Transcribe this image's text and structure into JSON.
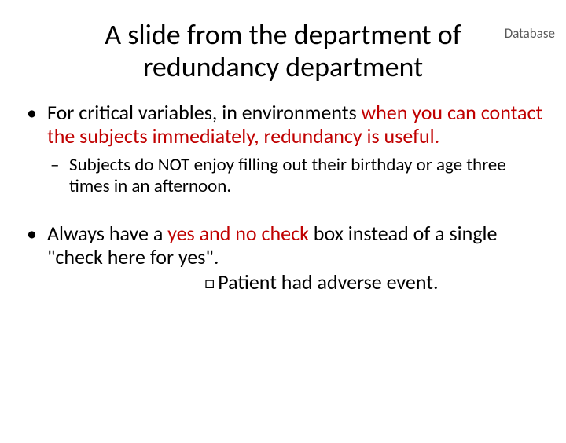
{
  "corner_label": "Database",
  "title": "A slide from the department of redundancy department",
  "bullets": {
    "b1_pre": "For critical variables, in environments ",
    "b1_red": "when you can contact the subjects immediately, redundancy is useful.",
    "b1_sub": "Subjects do NOT enjoy filling out their birthday or age three times in an afternoon.",
    "b2_pre": "Always have a ",
    "b2_red": "yes and no check ",
    "b2_post": "box instead of a single \"check here for yes\"."
  },
  "checkbox_line": "Patient had adverse event.",
  "checkbox_glyph": "□"
}
